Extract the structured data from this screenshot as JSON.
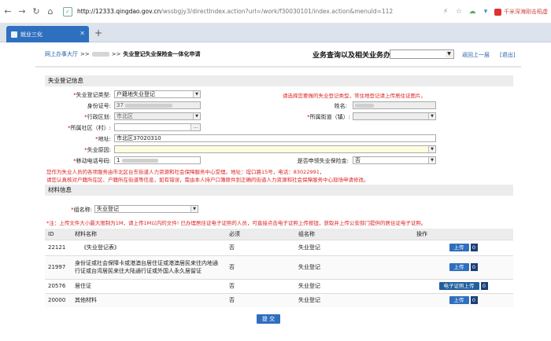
{
  "browser": {
    "url_host": "http://12333.qingdao.gov.cn",
    "url_rest": "/wssbgjy3/directIndex.action?url=/work/f30030101/index.action&menuId=112",
    "right_text": "千米深海刚击稻虚",
    "tab_title": "就业三化",
    "new_tab": "+"
  },
  "breadcrumb": {
    "home": "网上办事大厅",
    "sep": ">>",
    "current": "失业登记失业保险金一体化申请"
  },
  "business_query": {
    "label": "业务查询以及相关业务办理:",
    "selected": ""
  },
  "links": {
    "back": "返回上一层",
    "exit": "[退出]"
  },
  "section_register": "失业登记信息",
  "form": {
    "type_label": "失业登记类型:",
    "type_value": "户籍地失业登记",
    "type_hint": "请选择您要做的失业登记类型，常住地登记请上传居住证图片。",
    "id_label": "身份证号:",
    "id_value": "37",
    "name_label": "姓名:",
    "district_label": "行政区划:",
    "district_value": "市北区",
    "street_label": "所属街道（镇）:",
    "community_label": "所属社区（村）:",
    "community_dots": "...",
    "address_label": "地址:",
    "address_value": "市北区37020310",
    "reason_label": "失业原因:",
    "phone_label": "移动电话号码:",
    "phone_value": "1",
    "insurance_label": "是否申领失业保险金:",
    "insurance_value": "否",
    "notice_line1": "您作为失业人员的各项服务由市北区台东街道人力资源和社会保障服务中心受理。地址：埕口路15号，电话：83022991，",
    "notice_line2": "请您认真核对户籍所在区、户籍所在街道等信息，如有错误，需由本人持户口簿原件到正确的街道人力资源和社会保障服务中心现场申请修改。"
  },
  "section_materials": "材料信息",
  "materials": {
    "group_label": "组名称:",
    "group_value": "失业登记",
    "note": "*注：上传文件大小最大限制为1M，请上传1M以内的文件! 已办理居住证电子证照的人员，可直接点击电子证照上传按钮，获取并上传公安部门提供的居住证电子证照。",
    "columns": [
      "ID",
      "材料名称",
      "必须",
      "组名称",
      "操作"
    ],
    "rows": [
      {
        "id": "22121",
        "name": "《失业登记表》",
        "required": "否",
        "group": "失业登记",
        "action": "上传",
        "count": "0"
      },
      {
        "id": "21997",
        "name": "身份证或社会保障卡或港澳台居住证或港澳居民来往内地通行证或台湾居民来往大陆通行证或外国人永久居留证",
        "required": "否",
        "group": "失业登记",
        "action": "上传",
        "count": "0"
      },
      {
        "id": "20576",
        "name": "居住证",
        "required": "否",
        "group": "失业登记",
        "action": "电子证照上传",
        "count": "0"
      },
      {
        "id": "20000",
        "name": "其他材料",
        "required": "否",
        "group": "失业登记",
        "action": "上传",
        "count": "0"
      }
    ]
  },
  "submit_label": "提 交",
  "colors": {
    "accent": "#2f6fbf",
    "link": "#1f5fa6",
    "notice": "#d22"
  }
}
